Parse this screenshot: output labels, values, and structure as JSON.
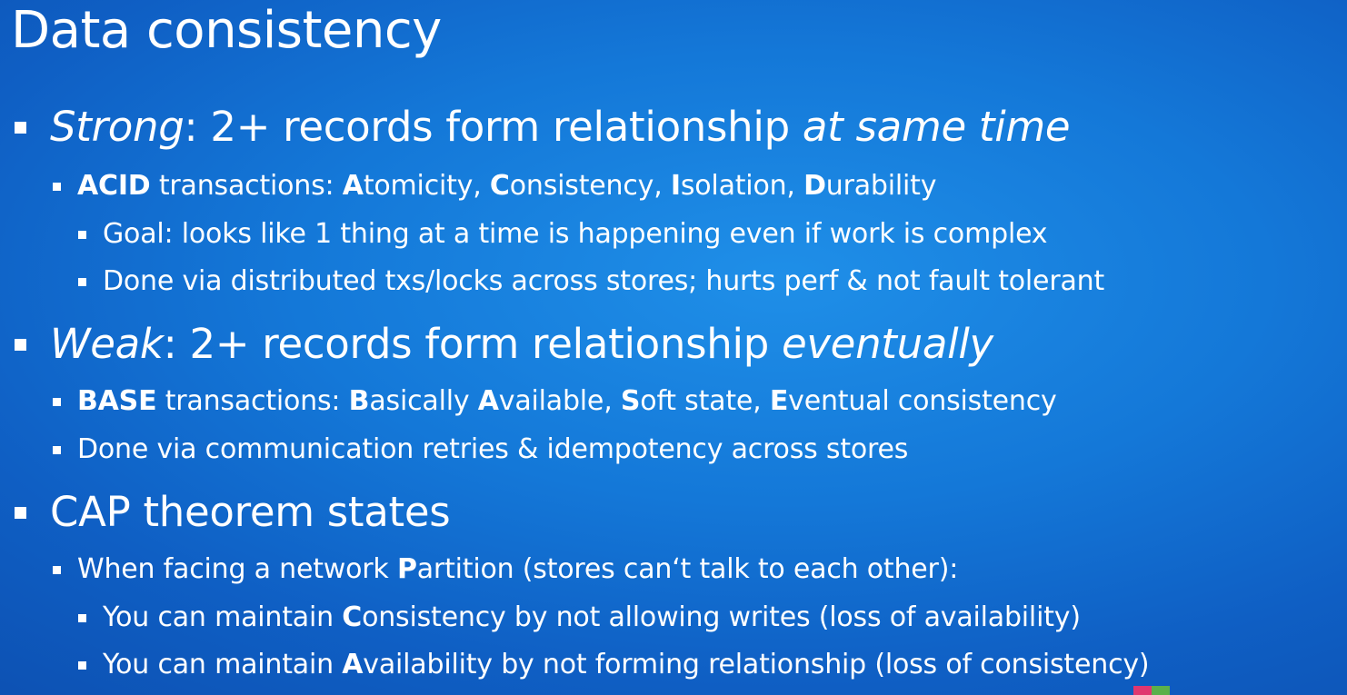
{
  "slide": {
    "title": "Data consistency",
    "strong": {
      "label": "Strong",
      "rest": ": 2+ records form relationship ",
      "emphasis": "at same time",
      "acid": {
        "term": "ACID",
        "text": " transactions: ",
        "a": "A",
        "a_rest": "tomicity, ",
        "c": "C",
        "c_rest": "onsistency, ",
        "i": "I",
        "i_rest": "solation, ",
        "d": "D",
        "d_rest": "urability"
      },
      "goal": "Goal: looks like 1 thing at a time is happening even if work is complex",
      "done": "Done via distributed txs/locks across stores; hurts perf & not fault tolerant"
    },
    "weak": {
      "label": "Weak",
      "rest": ": 2+ records form relationship ",
      "emphasis": "eventually",
      "base": {
        "term": "BASE",
        "text": " transactions: ",
        "b": "B",
        "b_rest": "asically ",
        "a": "A",
        "a_rest": "vailable, ",
        "s": "S",
        "s_rest": "oft state, ",
        "e": "E",
        "e_rest": "ventual consistency"
      },
      "done": "Done via communication retries & idempotency across stores"
    },
    "cap": {
      "heading": "CAP theorem states",
      "partition": {
        "pre": "When facing a network ",
        "key": "P",
        "post": "artition (stores can‘t talk to each other):"
      },
      "consistency": {
        "pre": "You can maintain ",
        "key": "C",
        "post": "onsistency by not allowing writes (loss of availability)"
      },
      "availability": {
        "pre": "You can maintain ",
        "key": "A",
        "post": "vailability by not forming relationship (loss of consistency)"
      }
    }
  },
  "colors": {
    "background_center": "#1f8fe8",
    "background_edge": "#0c4eaf",
    "text": "#ffffff",
    "logo_red": "#e0376f",
    "logo_green": "#5bb04a"
  }
}
